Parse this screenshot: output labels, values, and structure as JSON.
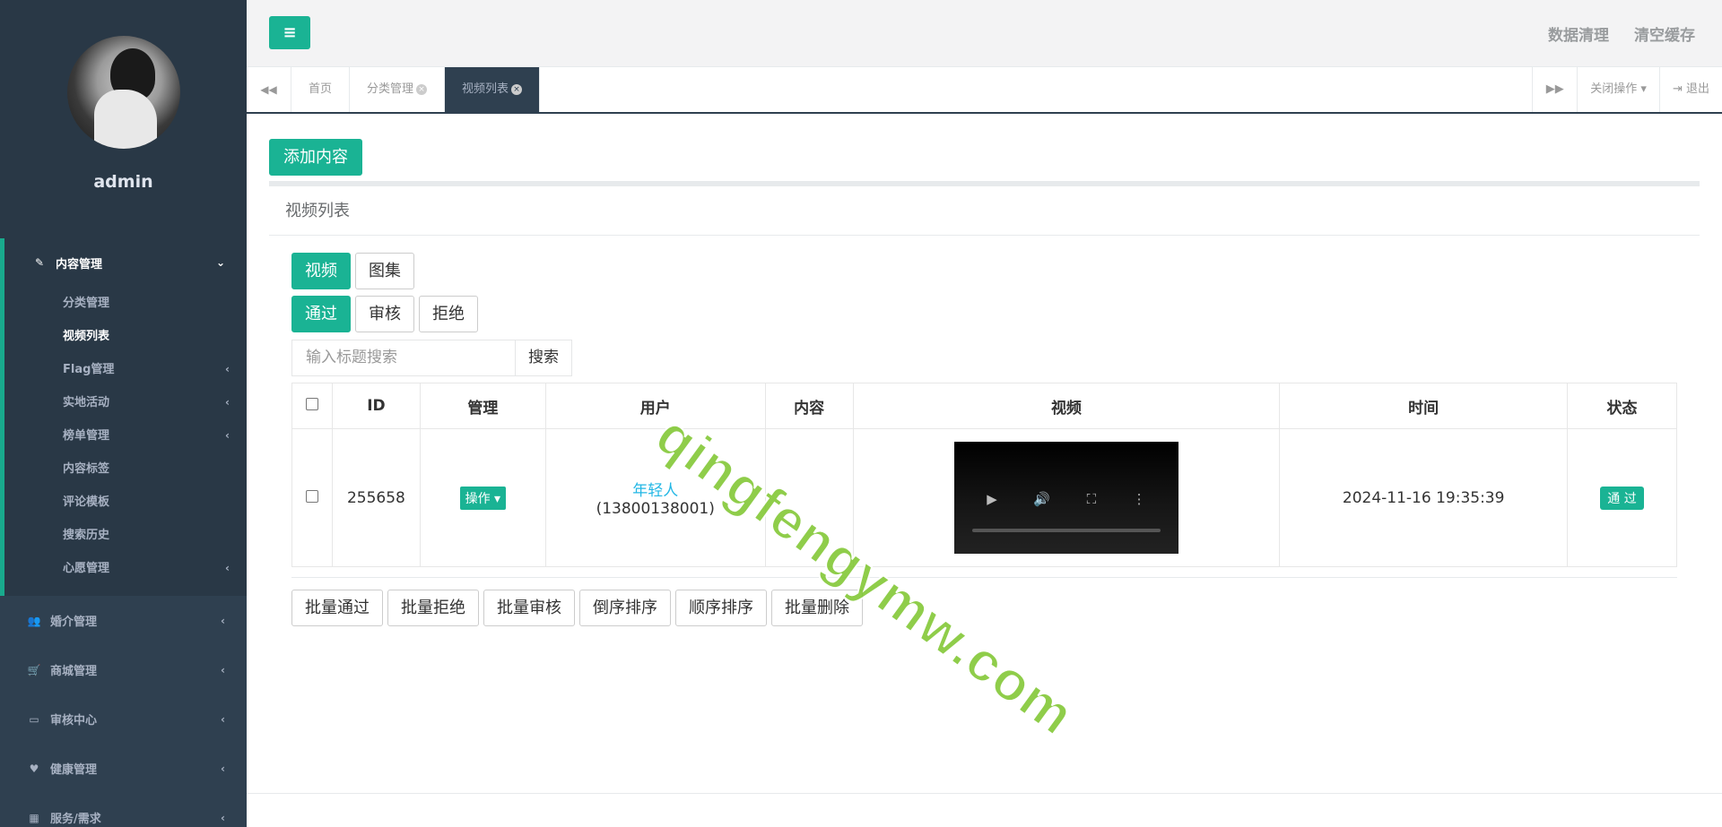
{
  "sidebar": {
    "user_name": "admin",
    "groups": [
      {
        "label": "内容管理",
        "icon": "edit-icon",
        "active": true,
        "items": [
          {
            "label": "分类管理",
            "has_arrow": false
          },
          {
            "label": "视频列表",
            "has_arrow": false,
            "current": true
          },
          {
            "label": "Flag管理",
            "has_arrow": true
          },
          {
            "label": "实地活动",
            "has_arrow": true
          },
          {
            "label": "榜单管理",
            "has_arrow": true
          },
          {
            "label": "内容标签",
            "has_arrow": false
          },
          {
            "label": "评论模板",
            "has_arrow": false
          },
          {
            "label": "搜索历史",
            "has_arrow": false
          },
          {
            "label": "心愿管理",
            "has_arrow": true
          }
        ]
      },
      {
        "label": "婚介管理",
        "icon": "users-icon"
      },
      {
        "label": "商城管理",
        "icon": "cart-icon"
      },
      {
        "label": "审核中心",
        "icon": "monitor-icon"
      },
      {
        "label": "健康管理",
        "icon": "heart-icon"
      },
      {
        "label": "服务/需求",
        "icon": "calendar-icon"
      }
    ]
  },
  "topbar": {
    "links": [
      "数据清理",
      "清空缓存"
    ]
  },
  "tabs": {
    "items": [
      {
        "label": "首页",
        "closable": false
      },
      {
        "label": "分类管理",
        "closable": true
      },
      {
        "label": "视频列表",
        "closable": true,
        "active": true
      }
    ],
    "close_ops": "关闭操作",
    "logout": "退出"
  },
  "content": {
    "add_button": "添加内容",
    "panel_title": "视频列表",
    "type_filters": [
      {
        "label": "视频",
        "active": true
      },
      {
        "label": "图集",
        "active": false
      }
    ],
    "status_filters": [
      {
        "label": "通过",
        "active": true
      },
      {
        "label": "审核",
        "active": false
      },
      {
        "label": "拒绝",
        "active": false
      }
    ],
    "search": {
      "placeholder": "输入标题搜索",
      "button": "搜索"
    },
    "table": {
      "headers": [
        "ID",
        "管理",
        "用户",
        "内容",
        "视频",
        "时间",
        "状态"
      ],
      "rows": [
        {
          "id": "255658",
          "op": "操作",
          "user_name": "年轻人",
          "user_phone": "(13800138001)",
          "content": "",
          "time": "2024-11-16 19:35:39",
          "status": "通 过"
        }
      ]
    },
    "batch_buttons": [
      "批量通过",
      "批量拒绝",
      "批量审核",
      "倒序排序",
      "顺序排序",
      "批量删除"
    ]
  },
  "watermark": "qingfengymw.com"
}
